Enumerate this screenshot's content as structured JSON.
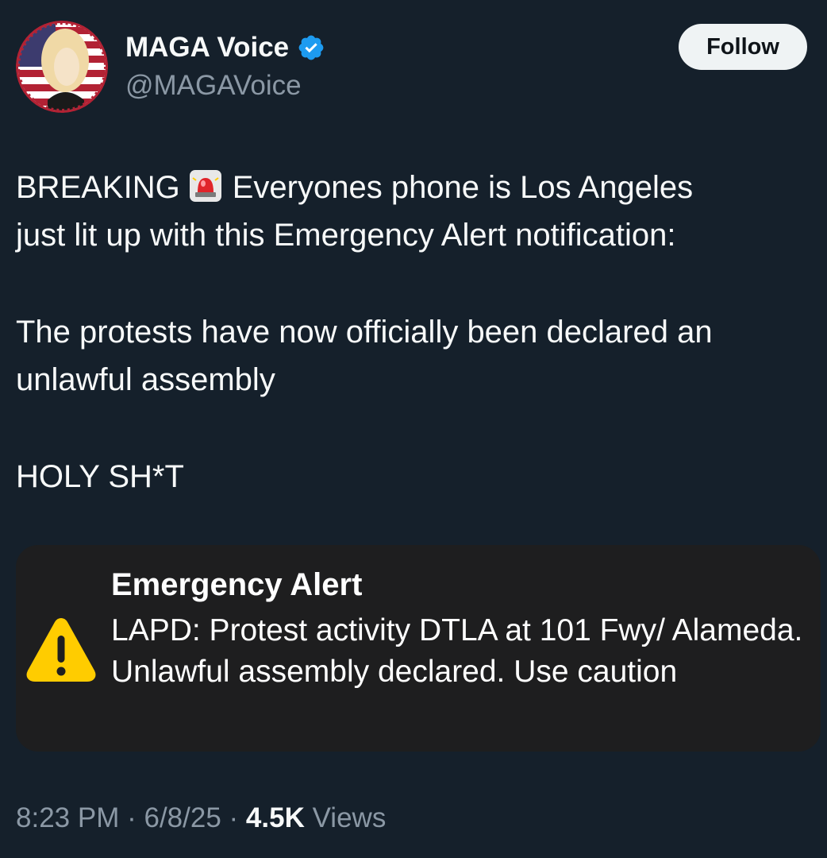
{
  "tweet": {
    "author": {
      "name": "MAGA Voice",
      "handle": "@MAGAVoice",
      "verified": true
    },
    "follow_label": "Follow",
    "text": {
      "line1_a": "BREAKING",
      "line1_b": "Everyones phone is Los Angeles",
      "line2": "just lit up with this Emergency Alert notification:",
      "line3": "The protests have now officially been declared an",
      "line4": "unlawful assembly",
      "line5": "HOLY SH*T"
    },
    "embedded_alert": {
      "title": "Emergency Alert",
      "body": "LAPD: Protest activity DTLA at 101 Fwy/ Alameda. Unlawful assembly declared. Use caution",
      "icon": "warning-icon"
    },
    "meta": {
      "time": "8:23 PM",
      "separator": "·",
      "date": "6/8/25",
      "views_count": "4.5K",
      "views_label": "Views"
    }
  },
  "colors": {
    "background": "#15202b",
    "primary_text": "#f7f9f9",
    "secondary_text": "#8b98a5",
    "verified_blue": "#1d9bf0",
    "follow_bg": "#eff3f4",
    "alert_card_bg": "#1e1e1f",
    "warning_yellow": "#ffcc00"
  }
}
